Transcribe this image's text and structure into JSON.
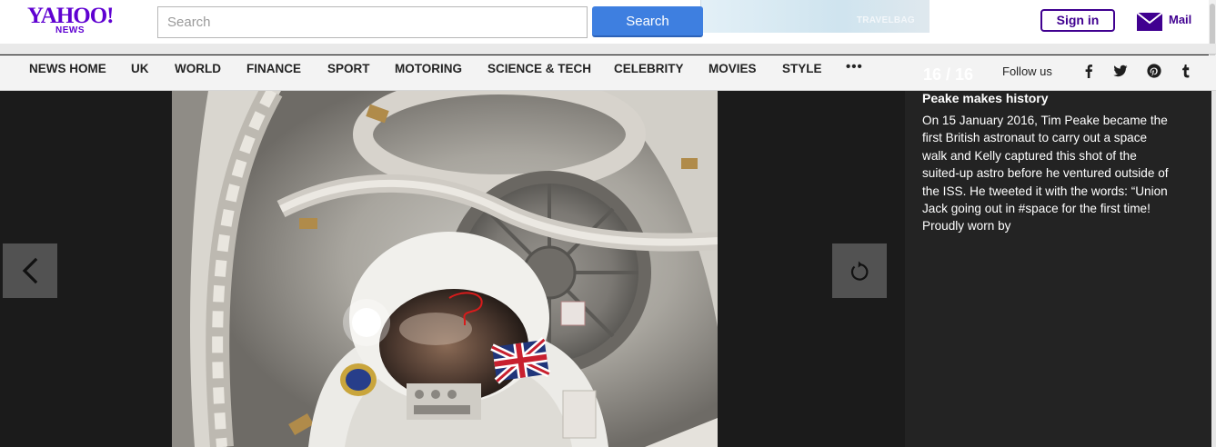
{
  "header": {
    "logo_main": "YAHOO!",
    "logo_sub": "NEWS",
    "search_placeholder": "Search",
    "search_button": "Search",
    "ad_text": "TRAVELBAG",
    "sign_in": "Sign in",
    "mail": "Mail"
  },
  "nav": {
    "items": [
      "NEWS HOME",
      "UK",
      "WORLD",
      "FINANCE",
      "SPORT",
      "MOTORING",
      "SCIENCE & TECH",
      "CELEBRITY",
      "MOVIES",
      "STYLE"
    ],
    "more": "•••",
    "follow_label": "Follow us",
    "social": [
      "facebook-icon",
      "twitter-icon",
      "pinterest-icon",
      "tumblr-icon"
    ]
  },
  "slideshow": {
    "counter": "16 / 16",
    "caption_title": "Peake makes history",
    "caption_body": "On 15 January 2016, Tim Peake became the first British astronaut to carry out a space walk and Kelly captured this shot of the suited-up astro before he ventured outside of the ISS. He tweeted it with the words: “Union Jack going out in #space for the first time! Proudly worn by",
    "prev_icon": "chevron-left-icon",
    "replay_icon": "replay-icon"
  },
  "colors": {
    "brand": "#400090",
    "search_button": "#3e7fe0",
    "stage": "#1b1b1b",
    "caption_panel": "#232323"
  }
}
